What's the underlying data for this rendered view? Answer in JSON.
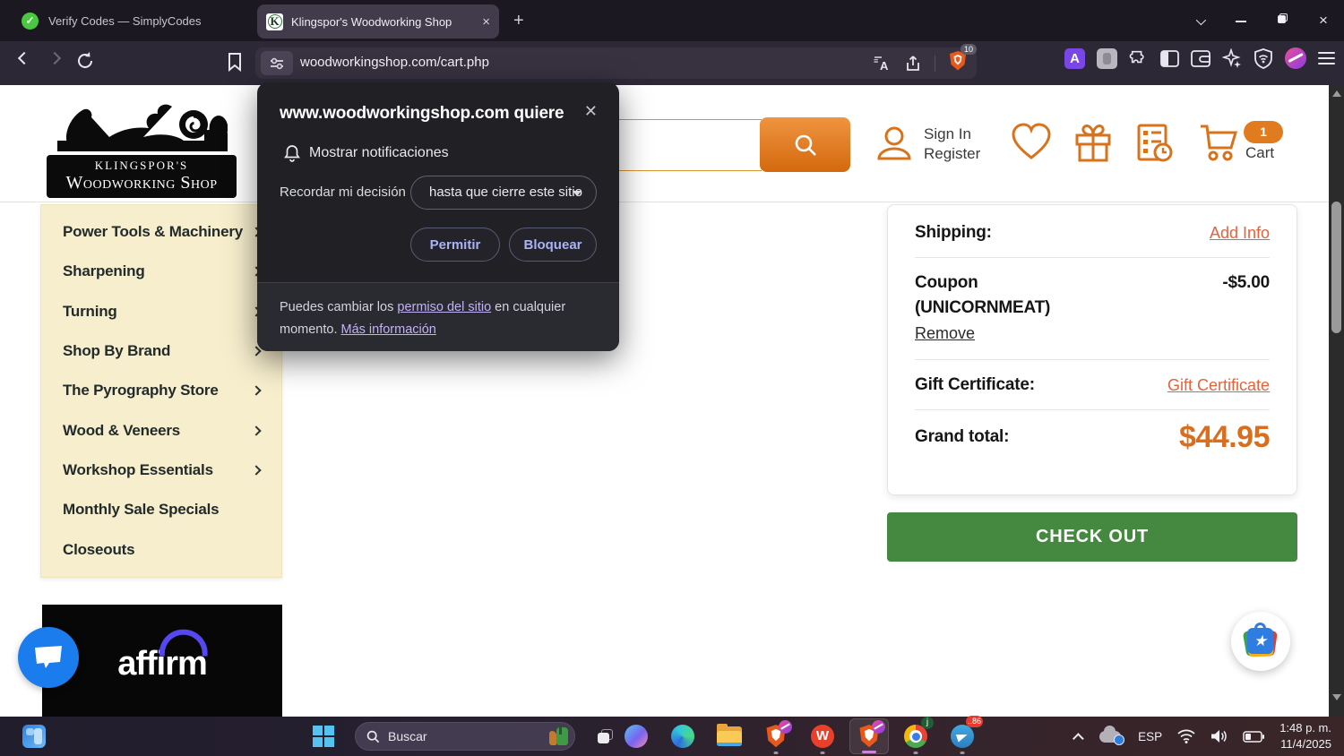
{
  "browser": {
    "tabs": [
      {
        "title": "Verify Codes — SimplyCodes"
      },
      {
        "title": "Klingspor's Woodworking Shop"
      }
    ],
    "url": "woodworkingshop.com/cart.php",
    "shield_badge": "10"
  },
  "dialog": {
    "title": "www.woodworkingshop.com quiere",
    "permission": "Mostrar notificaciones",
    "remember_label": "Recordar mi decisión",
    "remember_value": "hasta que cierre este sitio",
    "allow_label": "Permitir",
    "block_label": "Bloquear",
    "footer_pre": "Puedes cambiar los ",
    "footer_link_site": "permiso del sitio",
    "footer_mid": " en cualquier momento. ",
    "footer_link_more": "Más información"
  },
  "site": {
    "logo_line1": "KLINGSPOR'S",
    "logo_line2": "Woodworking Shop",
    "signin": "Sign In",
    "register": "Register",
    "cart_count": "1",
    "cart_label": "Cart",
    "menu": [
      {
        "label": "Power Tools & Machinery",
        "chevron": true
      },
      {
        "label": "Sharpening",
        "chevron": true
      },
      {
        "label": "Turning",
        "chevron": true
      },
      {
        "label": "Shop By Brand",
        "chevron": true
      },
      {
        "label": "The Pyrography Store",
        "chevron": true
      },
      {
        "label": "Wood & Veneers",
        "chevron": true
      },
      {
        "label": "Workshop Essentials",
        "chevron": true
      },
      {
        "label": "Monthly Sale Specials",
        "chevron": false
      },
      {
        "label": "Closeouts",
        "chevron": false
      }
    ],
    "summary": {
      "shipping_label": "Shipping:",
      "shipping_action": "Add Info",
      "coupon_label": "Coupon",
      "coupon_code": "(UNICORNMEAT)",
      "coupon_value": "-$5.00",
      "coupon_remove": "Remove",
      "gift_label": "Gift Certificate:",
      "gift_action": "Gift Certificate",
      "total_label": "Grand total:",
      "total_value": "$44.95",
      "checkout_label": "CHECK OUT"
    },
    "affirm_label": "affirm"
  },
  "taskbar": {
    "search_placeholder": "Buscar",
    "language": "ESP",
    "time": "1:48 p. m.",
    "date": "11/4/2025",
    "telegram_badge": "..86",
    "chrome_badge": "j"
  },
  "colors": {
    "accent_orange": "#e07b1f",
    "link_orange": "#e2633c",
    "checkout_green": "#45883f",
    "sidebar_cream": "#f7eecd",
    "dialog_accent": "#a9b4f8"
  }
}
